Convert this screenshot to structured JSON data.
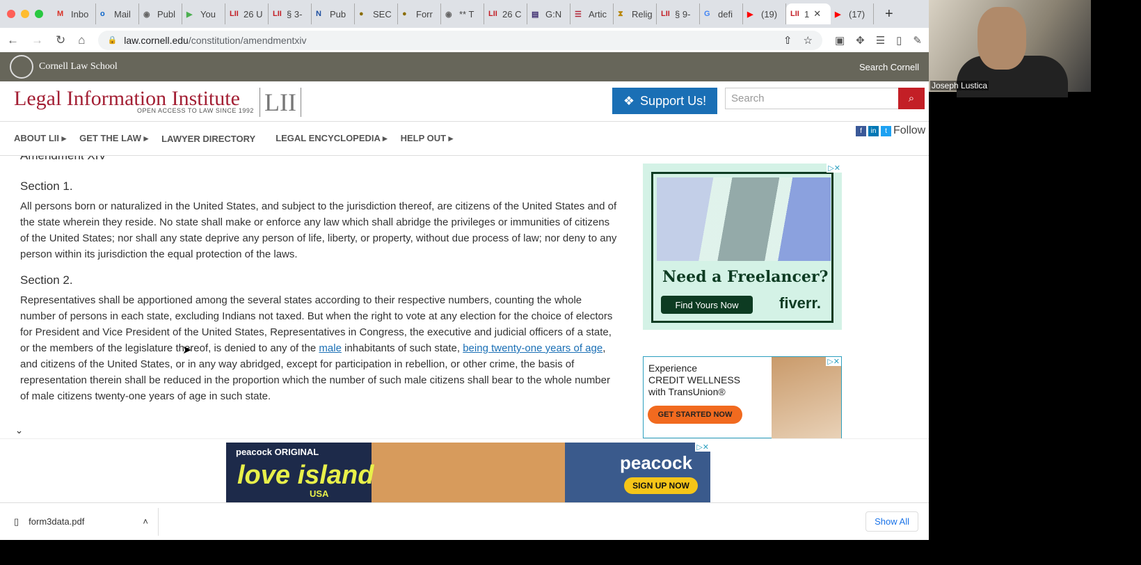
{
  "browser": {
    "tabs": [
      {
        "icon": "gmail-icon",
        "fav": "M",
        "favcolor": "#d93025",
        "label": "Inbo"
      },
      {
        "icon": "outlook-icon",
        "fav": "o",
        "favcolor": "#0a64c9",
        "label": "Mail"
      },
      {
        "icon": "globe-icon",
        "fav": "◉",
        "favcolor": "#666",
        "label": "Publ"
      },
      {
        "icon": "play-icon",
        "fav": "▶",
        "favcolor": "#4caf50",
        "label": "You"
      },
      {
        "icon": "lii-icon",
        "fav": "LII",
        "favcolor": "#c31f26",
        "label": "26 U"
      },
      {
        "icon": "lii-icon",
        "fav": "LII",
        "favcolor": "#c31f26",
        "label": "§ 3-"
      },
      {
        "icon": "n-icon",
        "fav": "N",
        "favcolor": "#1e4fa0",
        "label": "Pub"
      },
      {
        "icon": "sec-seal-icon",
        "fav": "●",
        "favcolor": "#8a6d00",
        "label": "SEC"
      },
      {
        "icon": "sec-seal-icon",
        "fav": "●",
        "favcolor": "#8a6d00",
        "label": "Forr"
      },
      {
        "icon": "globe-icon",
        "fav": "◉",
        "favcolor": "#666",
        "label": "** T"
      },
      {
        "icon": "lii-icon",
        "fav": "LII",
        "favcolor": "#c31f26",
        "label": "26 C"
      },
      {
        "icon": "book-icon",
        "fav": "▤",
        "favcolor": "#3b2a6e",
        "label": "G:N"
      },
      {
        "icon": "flag-icon",
        "fav": "☰",
        "favcolor": "#b22234",
        "label": "Artic"
      },
      {
        "icon": "hourglass-icon",
        "fav": "⧗",
        "favcolor": "#b8860b",
        "label": "Relig"
      },
      {
        "icon": "lii-icon",
        "fav": "LII",
        "favcolor": "#c31f26",
        "label": "§ 9-"
      },
      {
        "icon": "google-icon",
        "fav": "G",
        "favcolor": "#4285f4",
        "label": "defi"
      },
      {
        "icon": "youtube-icon",
        "fav": "▶",
        "favcolor": "#ff0000",
        "label": "(19)"
      },
      {
        "icon": "lii-icon",
        "fav": "LII",
        "favcolor": "#c31f26",
        "label": "1",
        "active": true
      },
      {
        "icon": "youtube-icon",
        "fav": "▶",
        "favcolor": "#ff0000",
        "label": "(17)"
      }
    ],
    "url_domain": "law.cornell.edu",
    "url_path": "/constitution/amendmentxiv"
  },
  "site": {
    "school": "Cornell Law School",
    "search_cornell": "Search Cornell",
    "logo": "Legal Information Institute",
    "tagline": "OPEN ACCESS TO LAW SINCE 1992",
    "lii": "LII",
    "support": "Support Us!",
    "search_placeholder": "Search",
    "nav": [
      "ABOUT LII ▸",
      "GET THE LAW ▸",
      "LAWYER DIRECTORY",
      "LEGAL ENCYCLOPEDIA ▸",
      "HELP OUT ▸"
    ],
    "follow": "Follow"
  },
  "article": {
    "heading_clipped": "Amendment XIV",
    "s1_title": "Section 1.",
    "s1_text": "All persons born or naturalized in the United States, and subject to the jurisdiction thereof, are citizens of the United States and of the state wherein they reside. No state shall make or enforce any law which shall abridge the privileges or immunities of citizens of the United States; nor shall any state deprive any person of life, liberty, or property, without due process of law; nor deny to any person within its jurisdiction the equal protection of the laws.",
    "s2_title": "Section 2.",
    "s2_a": "Representatives shall be apportioned among the several states according to their respective numbers, counting the whole number of persons in each state, excluding Indians not taxed. But when the right to vote at any election for the choice of electors for President and Vice President of the United States, Representatives in Congress, the executive and judicial officers of a state, or the members of the legislature thereof, is denied to any of the ",
    "s2_link1": "male",
    "s2_b": " inhabitants of such state, ",
    "s2_link2": "being twenty-one years of age",
    "s2_c": ", and citizens of the United States, or in any way abridged, except for participation in rebellion, or other crime, the basis of representation therein shall be reduced in the proportion which the number of such male citizens shall bear to the whole number of male citizens twenty-one years of age in such state."
  },
  "ads": {
    "fiverr_headline": "Need a Freelancer?",
    "fiverr_cta": "Find Yours Now",
    "fiverr_brand": "fiverr.",
    "tu_line1": "Experience",
    "tu_line2": "CREDIT WELLNESS",
    "tu_line3": "with TransUnion®",
    "tu_cta": "GET STARTED NOW",
    "peacock_original": "peacock ORIGINAL",
    "peacock_show": "love island",
    "peacock_usa": "USA",
    "peacock_brand": "peacock",
    "peacock_cta": "SIGN UP NOW",
    "adchoices": "▷✕"
  },
  "downloads": {
    "file": "form3data.pdf",
    "show_all": "Show All"
  },
  "webcam": {
    "name": "Joseph Lustica"
  }
}
